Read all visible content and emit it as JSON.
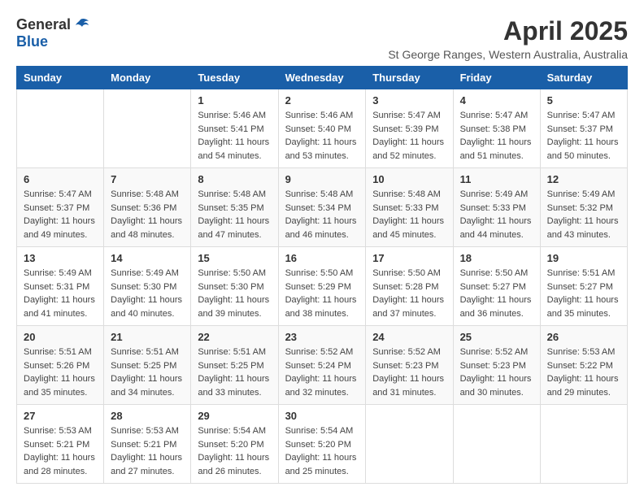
{
  "logo": {
    "general": "General",
    "blue": "Blue"
  },
  "title": "April 2025",
  "location": "St George Ranges, Western Australia, Australia",
  "days_of_week": [
    "Sunday",
    "Monday",
    "Tuesday",
    "Wednesday",
    "Thursday",
    "Friday",
    "Saturday"
  ],
  "weeks": [
    [
      {
        "day": "",
        "info": ""
      },
      {
        "day": "",
        "info": ""
      },
      {
        "day": "1",
        "info": "Sunrise: 5:46 AM\nSunset: 5:41 PM\nDaylight: 11 hours\nand 54 minutes."
      },
      {
        "day": "2",
        "info": "Sunrise: 5:46 AM\nSunset: 5:40 PM\nDaylight: 11 hours\nand 53 minutes."
      },
      {
        "day": "3",
        "info": "Sunrise: 5:47 AM\nSunset: 5:39 PM\nDaylight: 11 hours\nand 52 minutes."
      },
      {
        "day": "4",
        "info": "Sunrise: 5:47 AM\nSunset: 5:38 PM\nDaylight: 11 hours\nand 51 minutes."
      },
      {
        "day": "5",
        "info": "Sunrise: 5:47 AM\nSunset: 5:37 PM\nDaylight: 11 hours\nand 50 minutes."
      }
    ],
    [
      {
        "day": "6",
        "info": "Sunrise: 5:47 AM\nSunset: 5:37 PM\nDaylight: 11 hours\nand 49 minutes."
      },
      {
        "day": "7",
        "info": "Sunrise: 5:48 AM\nSunset: 5:36 PM\nDaylight: 11 hours\nand 48 minutes."
      },
      {
        "day": "8",
        "info": "Sunrise: 5:48 AM\nSunset: 5:35 PM\nDaylight: 11 hours\nand 47 minutes."
      },
      {
        "day": "9",
        "info": "Sunrise: 5:48 AM\nSunset: 5:34 PM\nDaylight: 11 hours\nand 46 minutes."
      },
      {
        "day": "10",
        "info": "Sunrise: 5:48 AM\nSunset: 5:33 PM\nDaylight: 11 hours\nand 45 minutes."
      },
      {
        "day": "11",
        "info": "Sunrise: 5:49 AM\nSunset: 5:33 PM\nDaylight: 11 hours\nand 44 minutes."
      },
      {
        "day": "12",
        "info": "Sunrise: 5:49 AM\nSunset: 5:32 PM\nDaylight: 11 hours\nand 43 minutes."
      }
    ],
    [
      {
        "day": "13",
        "info": "Sunrise: 5:49 AM\nSunset: 5:31 PM\nDaylight: 11 hours\nand 41 minutes."
      },
      {
        "day": "14",
        "info": "Sunrise: 5:49 AM\nSunset: 5:30 PM\nDaylight: 11 hours\nand 40 minutes."
      },
      {
        "day": "15",
        "info": "Sunrise: 5:50 AM\nSunset: 5:30 PM\nDaylight: 11 hours\nand 39 minutes."
      },
      {
        "day": "16",
        "info": "Sunrise: 5:50 AM\nSunset: 5:29 PM\nDaylight: 11 hours\nand 38 minutes."
      },
      {
        "day": "17",
        "info": "Sunrise: 5:50 AM\nSunset: 5:28 PM\nDaylight: 11 hours\nand 37 minutes."
      },
      {
        "day": "18",
        "info": "Sunrise: 5:50 AM\nSunset: 5:27 PM\nDaylight: 11 hours\nand 36 minutes."
      },
      {
        "day": "19",
        "info": "Sunrise: 5:51 AM\nSunset: 5:27 PM\nDaylight: 11 hours\nand 35 minutes."
      }
    ],
    [
      {
        "day": "20",
        "info": "Sunrise: 5:51 AM\nSunset: 5:26 PM\nDaylight: 11 hours\nand 35 minutes."
      },
      {
        "day": "21",
        "info": "Sunrise: 5:51 AM\nSunset: 5:25 PM\nDaylight: 11 hours\nand 34 minutes."
      },
      {
        "day": "22",
        "info": "Sunrise: 5:51 AM\nSunset: 5:25 PM\nDaylight: 11 hours\nand 33 minutes."
      },
      {
        "day": "23",
        "info": "Sunrise: 5:52 AM\nSunset: 5:24 PM\nDaylight: 11 hours\nand 32 minutes."
      },
      {
        "day": "24",
        "info": "Sunrise: 5:52 AM\nSunset: 5:23 PM\nDaylight: 11 hours\nand 31 minutes."
      },
      {
        "day": "25",
        "info": "Sunrise: 5:52 AM\nSunset: 5:23 PM\nDaylight: 11 hours\nand 30 minutes."
      },
      {
        "day": "26",
        "info": "Sunrise: 5:53 AM\nSunset: 5:22 PM\nDaylight: 11 hours\nand 29 minutes."
      }
    ],
    [
      {
        "day": "27",
        "info": "Sunrise: 5:53 AM\nSunset: 5:21 PM\nDaylight: 11 hours\nand 28 minutes."
      },
      {
        "day": "28",
        "info": "Sunrise: 5:53 AM\nSunset: 5:21 PM\nDaylight: 11 hours\nand 27 minutes."
      },
      {
        "day": "29",
        "info": "Sunrise: 5:54 AM\nSunset: 5:20 PM\nDaylight: 11 hours\nand 26 minutes."
      },
      {
        "day": "30",
        "info": "Sunrise: 5:54 AM\nSunset: 5:20 PM\nDaylight: 11 hours\nand 25 minutes."
      },
      {
        "day": "",
        "info": ""
      },
      {
        "day": "",
        "info": ""
      },
      {
        "day": "",
        "info": ""
      }
    ]
  ]
}
